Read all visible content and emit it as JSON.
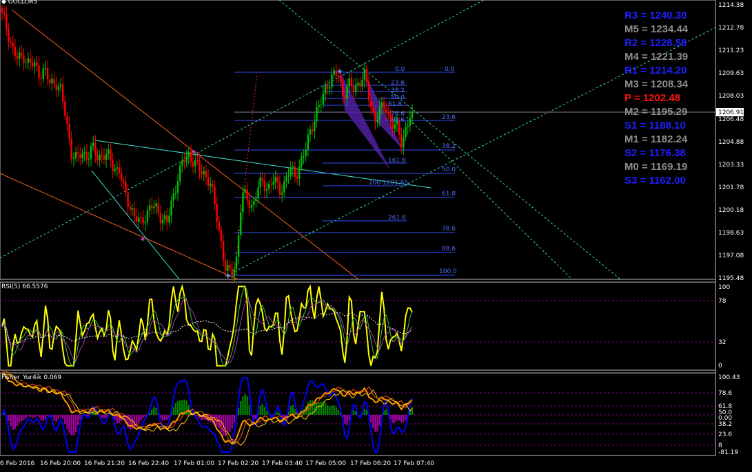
{
  "symbol_label": "GOLD,M5",
  "current_price": "1206.91",
  "colors": {
    "bg": "#000000",
    "up": "#00c000",
    "down": "#ff0000",
    "grid": "#c0c0c0",
    "pivot_blue": "#0000ff",
    "pivot_gray": "#808080",
    "pivot_red": "#ff0000",
    "rsi": "#ffff00",
    "fisher_blue": "#0000ff",
    "fisher_orange": "#ff8c00"
  },
  "pivots": [
    {
      "text": "R3 = 1240.30",
      "color": "#1f1fff"
    },
    {
      "text": "M5 = 1234.44",
      "color": "#8c8c8c"
    },
    {
      "text": "R2 = 1228.58",
      "color": "#1f1fff"
    },
    {
      "text": "M4 = 1221.39",
      "color": "#8c8c8c"
    },
    {
      "text": "R1 = 1214.20",
      "color": "#1f1fff"
    },
    {
      "text": "M3 = 1208.34",
      "color": "#8c8c8c"
    },
    {
      "text": "P  = 1202.48",
      "color": "#ff1010"
    },
    {
      "text": "M2 = 1195.29",
      "color": "#8c8c8c"
    },
    {
      "text": "S1 = 1188.10",
      "color": "#1f1fff"
    },
    {
      "text": "M1 = 1182.24",
      "color": "#8c8c8c"
    },
    {
      "text": "S2 = 1176.38",
      "color": "#1f1fff"
    },
    {
      "text": "M0 = 1169.19",
      "color": "#8c8c8c"
    },
    {
      "text": "S3 = 1162.00",
      "color": "#1f1fff"
    }
  ],
  "price_axis": [
    "1214.38",
    "1212.78",
    "1211.23",
    "1209.63",
    "1208.03",
    "1206.48",
    "1204.88",
    "1203.33",
    "1201.78",
    "1200.18",
    "1198.63",
    "1197.08",
    "1195.48"
  ],
  "fib_labels_left": [
    "0.0",
    "23.6",
    "38.2",
    "50.0",
    "61.8",
    "78.6",
    "88.6",
    "161.8",
    "200 1201.65",
    "261.8"
  ],
  "fib_labels_right": [
    "0.0",
    "23.6",
    "38.2",
    "50.0",
    "61.8",
    "78.6",
    "88.6",
    "100.0"
  ],
  "rsi": {
    "label": "RSI(5) 66.5576",
    "axis": [
      "100",
      "78",
      "32",
      "0"
    ]
  },
  "fisher": {
    "label": "Fisher_Yur4ik 0.069",
    "axis": [
      "100.43",
      "78.6",
      "61.8",
      "50.0",
      "0.00",
      "38.2",
      "23.6",
      "8",
      "-81.19"
    ]
  },
  "time_axis": [
    "6 Feb 2016",
    "16 Feb 20:00",
    "16 Feb 21:20",
    "16 Feb 22:40",
    "17 Feb 01:00",
    "17 Feb 02:20",
    "17 Feb 03:40",
    "17 Feb 05:00",
    "17 Feb 06:20",
    "17 Feb 07:40"
  ],
  "chart_data": {
    "type": "candlestick",
    "symbol": "GOLD",
    "timeframe": "M5",
    "ylim": [
      1195.48,
      1214.38
    ],
    "last_price": 1206.91,
    "close_path": [
      1213.5,
      1212.6,
      1211.2,
      1210.4,
      1210.9,
      1210.2,
      1210.1,
      1209.6,
      1209.7,
      1208.8,
      1209.1,
      1208.3,
      1206.4,
      1204.2,
      1203.5,
      1204.1,
      1203.9,
      1204.3,
      1203.8,
      1204.0,
      1203.7,
      1203.1,
      1202.9,
      1201.2,
      1200.5,
      1199.6,
      1199.1,
      1199.9,
      1200.4,
      1200.1,
      1199.7,
      1199.2,
      1200.8,
      1202.5,
      1203.4,
      1203.9,
      1203.6,
      1202.8,
      1202.6,
      1202.2,
      1200.2,
      1198.2,
      1196.1,
      1195.5,
      1196.8,
      1201.1,
      1200.9,
      1200.4,
      1201.6,
      1202.0,
      1201.7,
      1202.2,
      1201.5,
      1202.0,
      1202.8,
      1202.6,
      1203.3,
      1204.2,
      1205.9,
      1206.8,
      1207.6,
      1208.9,
      1209.2,
      1209.6,
      1208.1,
      1208.7,
      1208.5,
      1209.0,
      1209.4,
      1207.7,
      1206.4,
      1206.9,
      1207.4,
      1206.1,
      1205.8,
      1204.9,
      1205.9,
      1206.91
    ],
    "rsi_period": 5,
    "rsi_last": 66.5576,
    "fisher_last": 0.069
  }
}
